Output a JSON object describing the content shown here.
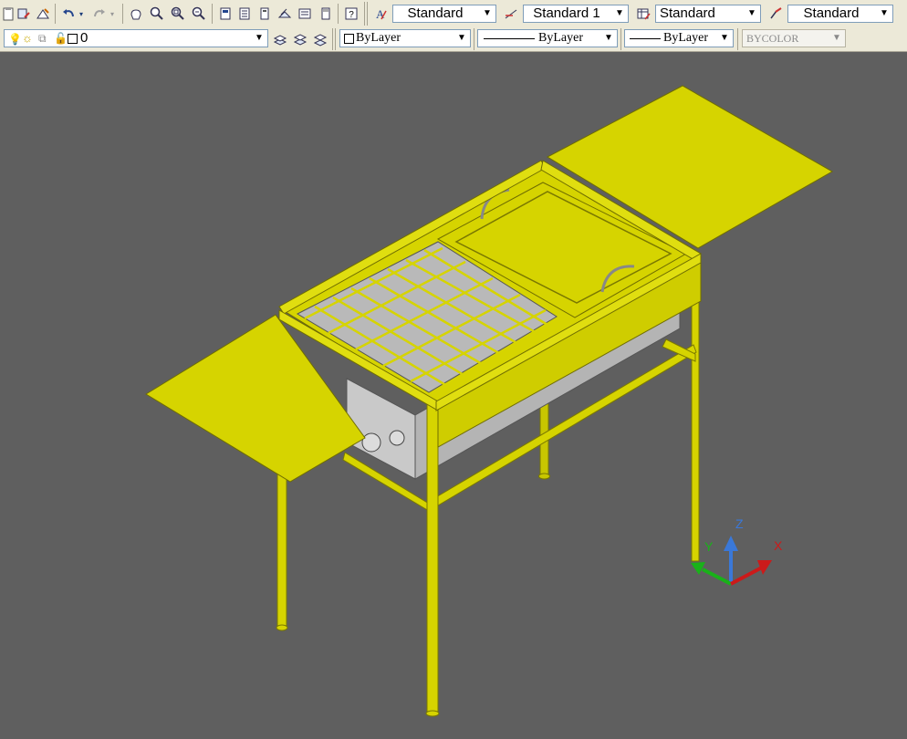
{
  "toolbar_row1": {
    "text_style": "Standard",
    "dim_style": "Standard 1",
    "table_style": "Standard",
    "multileader_style": "Standard"
  },
  "toolbar_row2": {
    "layer_value": "0",
    "color_value": "ByLayer",
    "linetype_value": "ByLayer",
    "lineweight_value": "ByLayer",
    "plotstyle_value": "BYCOLOR"
  },
  "ucs": {
    "x_label": "X",
    "y_label": "Y",
    "z_label": "Z"
  },
  "colors": {
    "model": "#d6d400",
    "model_dark": "#9e9c00",
    "grey_part": "#b8b8b8",
    "background": "#5f5f5f"
  }
}
